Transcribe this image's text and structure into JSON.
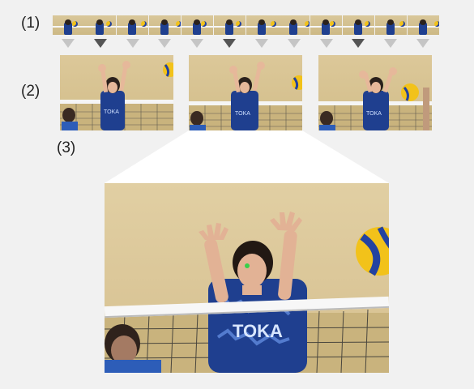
{
  "labels": {
    "step1": "(1)",
    "step2": "(2)",
    "step3": "(3)"
  },
  "strip": {
    "count": 12,
    "selected": [
      1,
      5,
      9
    ]
  },
  "big_jersey_text": "TOKA",
  "colors": {
    "background": "#f1f1f1",
    "arrow_default": "#c5c5c5",
    "arrow_selected": "#555555",
    "jersey": "#1f3f8f",
    "ball_yellow": "#f2c21a",
    "ball_blue": "#2342a0",
    "focus_point": "#39d04a"
  }
}
